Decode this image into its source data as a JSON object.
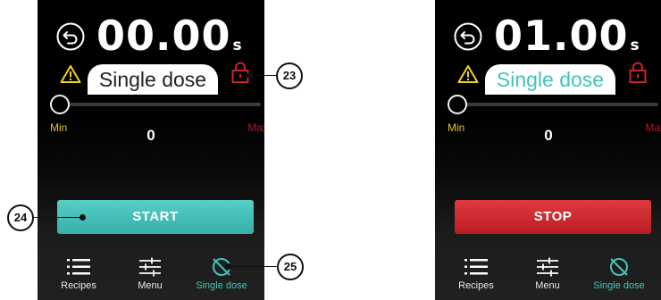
{
  "left_screen": {
    "time": {
      "value": "00.00",
      "unit": "s"
    },
    "mode_label": "Single dose",
    "slider": {
      "min_label": "Min",
      "max_label": "Max",
      "value": "0",
      "level": 0
    },
    "action_button": "START",
    "nav": {
      "recipes": "Recipes",
      "menu": "Menu",
      "single_dose": "Single dose",
      "active": "single_dose"
    }
  },
  "right_screen": {
    "time": {
      "value": "01.00",
      "unit": "s"
    },
    "mode_label": "Single dose",
    "slider": {
      "min_label": "Min",
      "max_label": "Max",
      "value": "0",
      "level": 0
    },
    "action_button": "STOP",
    "nav": {
      "recipes": "Recipes",
      "menu": "Menu",
      "single_dose": "Single dose",
      "active": "single_dose"
    }
  },
  "callouts": [
    "23",
    "24",
    "25"
  ],
  "colors": {
    "accent_teal": "#3fc5bb",
    "start_green": "#3bb7ae",
    "stop_red": "#c8232a",
    "warning_yellow": "#f4d21c",
    "min_yellow": "#e7c21a",
    "max_red": "#a81c24"
  },
  "icons": [
    "back-arrow-icon",
    "warning-icon",
    "lock-icon",
    "list-icon",
    "sliders-icon",
    "single-dose-icon"
  ]
}
